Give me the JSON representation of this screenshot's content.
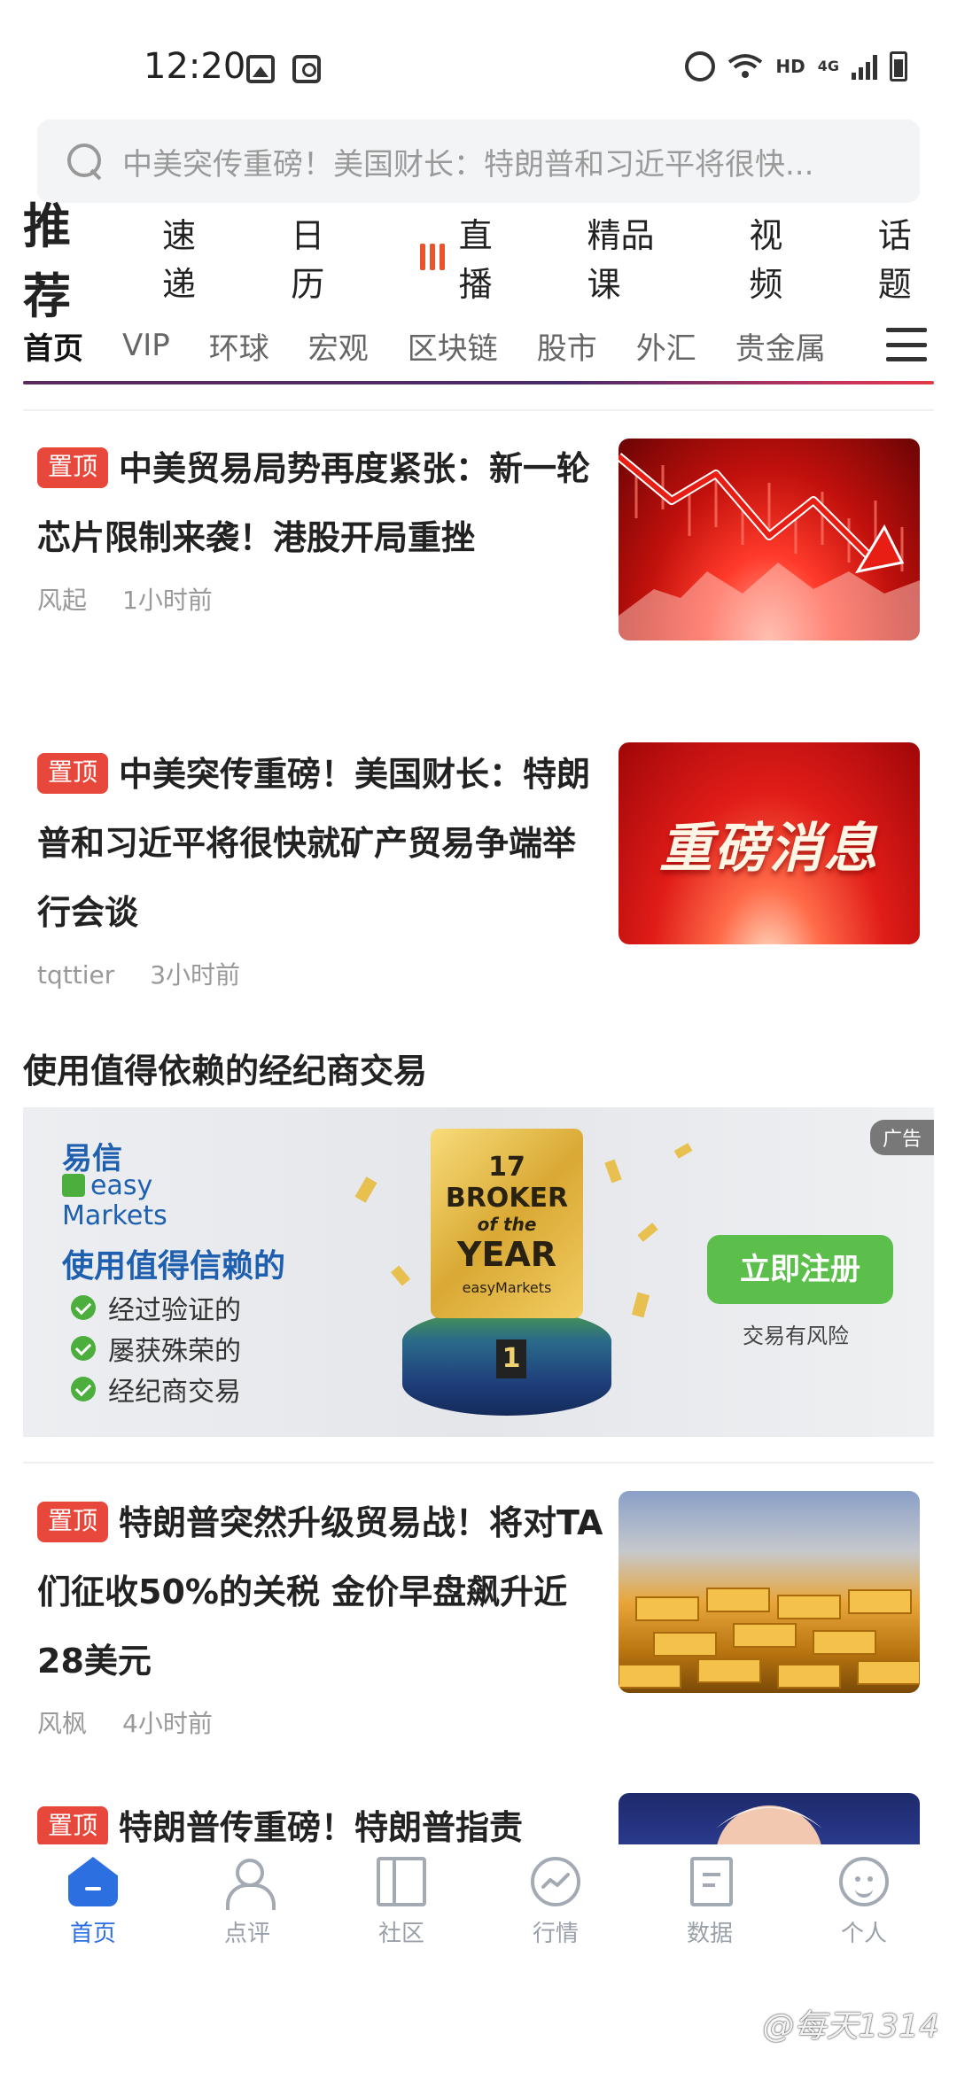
{
  "status_bar": {
    "time": "12:20",
    "icons_left": [
      "image-icon",
      "clock-app-icon"
    ],
    "icons_right": [
      "alarm-icon",
      "wifi-icon",
      "hd-icon",
      "4g-signal-icon",
      "battery-icon"
    ],
    "hd_label": "HD",
    "network_label": "4G"
  },
  "search": {
    "placeholder": "中美突传重磅！美国财长：特朗普和习近平将很快..."
  },
  "top_nav": {
    "active": "推荐",
    "items": [
      "速递",
      "日历",
      "直播",
      "精品课",
      "视频",
      "话题"
    ]
  },
  "category_tabs": {
    "items": [
      "首页",
      "VIP",
      "环球",
      "宏观",
      "区块链",
      "股市",
      "外汇",
      "贵金属"
    ],
    "active_index": 0
  },
  "news": [
    {
      "badge": "置顶",
      "title": "中美贸易局势再度紧张：新一轮芯片限制来袭！港股开局重挫",
      "author": "风起",
      "time": "1小时前"
    },
    {
      "badge": "置顶",
      "title": "中美突传重磅！美国财长：特朗普和习近平将很快就矿产贸易争端举行会谈",
      "author": "tqttier",
      "time": "3小时前",
      "thumb_text": "重磅消息"
    },
    {
      "badge": "置顶",
      "title": "特朗普突然升级贸易战！将对TA们征收50%的关税 金价早盘飙升近28美元",
      "author": "风枫",
      "time": "4小时前"
    },
    {
      "badge": "置顶",
      "title": "特朗普传重磅！特朗普指责"
    }
  ],
  "ad": {
    "heading": "使用值得依赖的经纪商交易",
    "brand_cn": "易信",
    "brand_en_1": "easy",
    "brand_en_2": "Markets",
    "tagline": "使用值得信赖的",
    "points": [
      "经过验证的",
      "屡获殊荣的",
      "经纪商交易"
    ],
    "trophy_logo": "17",
    "trophy_line1": "BROKER",
    "trophy_line2": "of the",
    "trophy_line3": "YEAR",
    "trophy_brand": "easyMarkets",
    "pedestal_number": "1",
    "cta": "立即注册",
    "risk": "交易有风险",
    "label": "广告",
    "colors": {
      "brand_blue": "#1e5fb0",
      "brand_green": "#5cbf4c"
    }
  },
  "bottom_nav": {
    "items": [
      {
        "label": "首页",
        "icon": "home-icon",
        "active": true
      },
      {
        "label": "点评",
        "icon": "person-icon",
        "active": false
      },
      {
        "label": "社区",
        "icon": "book-icon",
        "active": false
      },
      {
        "label": "行情",
        "icon": "trend-icon",
        "active": false
      },
      {
        "label": "数据",
        "icon": "document-icon",
        "active": false
      },
      {
        "label": "个人",
        "icon": "face-icon",
        "active": false
      }
    ]
  },
  "watermark": "@每天1314",
  "colors": {
    "accent_blue": "#2c6fe0",
    "badge_red": "#e8483c",
    "live_orange": "#e8542c"
  }
}
